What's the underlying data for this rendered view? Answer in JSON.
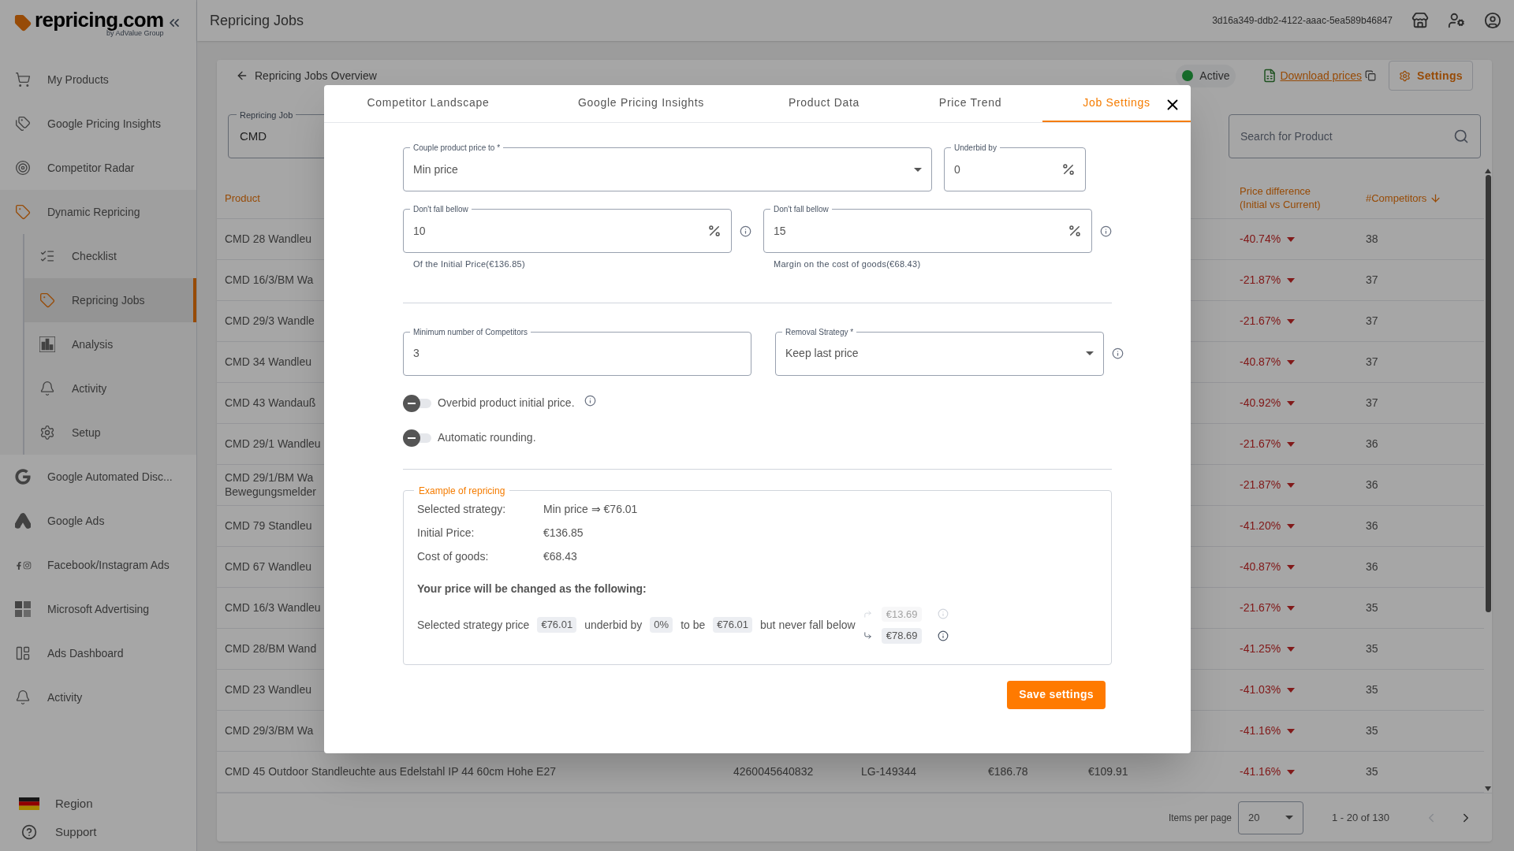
{
  "sidebar": {
    "logo": "repricing.com",
    "logo_tagline": "by AdValue Group",
    "items": [
      {
        "label": "My Products",
        "selected": false
      },
      {
        "label": "Google Pricing Insights",
        "selected": false
      },
      {
        "label": "Competitor Radar",
        "selected": false
      },
      {
        "label": "Dynamic Repricing",
        "selected": true,
        "children": [
          {
            "label": "Checklist",
            "selected": false
          },
          {
            "label": "Repricing Jobs",
            "selected": true
          },
          {
            "label": "Analysis",
            "selected": false
          },
          {
            "label": "Activity",
            "selected": false
          },
          {
            "label": "Setup",
            "selected": false
          }
        ]
      },
      {
        "label": "Google Automated Disc...",
        "selected": false
      },
      {
        "label": "Google Ads",
        "selected": false
      },
      {
        "label": "Facebook/Instagram Ads",
        "selected": false
      },
      {
        "label": "Microsoft Advertising",
        "selected": false
      },
      {
        "label": "Ads Dashboard",
        "selected": false
      },
      {
        "label": "Activity",
        "selected": false
      }
    ],
    "footer": [
      {
        "label": "Region"
      },
      {
        "label": "Support"
      }
    ]
  },
  "topbar": {
    "title": "Repricing Jobs",
    "account_id": "3d16a349-ddb2-4122-aaac-5ea589b46847"
  },
  "page": {
    "back_link": "Repricing Jobs Overview",
    "status": {
      "label": "Active",
      "on": true
    },
    "download_link": "Download prices",
    "settings_button": "Settings",
    "job_field": {
      "label": "Repricing Job",
      "value": "CMD"
    },
    "search": {
      "placeholder": "Search for Product"
    }
  },
  "table": {
    "columns": [
      {
        "label": "Product"
      },
      {
        "label": "Price difference (Initial vs Current)"
      },
      {
        "label": "#Competitors"
      }
    ],
    "rows": [
      {
        "product": "CMD 28 Wandleu",
        "diff": "-40.74%",
        "competitors": "38"
      },
      {
        "product": "CMD 16/3/BM Wa",
        "diff": "-21.87%",
        "competitors": "37"
      },
      {
        "product": "CMD 29/3 Wandle",
        "diff": "-21.67%",
        "competitors": "37"
      },
      {
        "product": "CMD 34 Wandleu",
        "diff": "-40.87%",
        "competitors": "37"
      },
      {
        "product": "CMD 43 Wandauß",
        "diff": "-40.92%",
        "competitors": "37"
      },
      {
        "product": "CMD 29/1 Wandleu",
        "diff": "-21.67%",
        "competitors": "36"
      },
      {
        "product": "CMD 29/1/BM Wa\nBewegungsmelder",
        "diff": "-21.87%",
        "competitors": "36"
      },
      {
        "product": "CMD 79 Standleu",
        "diff": "-41.20%",
        "competitors": "36"
      },
      {
        "product": "CMD 67 Wandleu",
        "diff": "-40.87%",
        "competitors": "36"
      },
      {
        "product": "CMD 16/3 Wandleu",
        "diff": "-21.67%",
        "competitors": "35"
      },
      {
        "product": "CMD 28/BM Wand",
        "diff": "-41.25%",
        "competitors": "35"
      },
      {
        "product": "CMD 23 Wandleu",
        "diff": "-41.03%",
        "competitors": "35"
      },
      {
        "product": "CMD 29/3/BM Wa",
        "diff": "-41.16%",
        "competitors": "35"
      },
      {
        "product": "CMD 45 Outdoor Standleuchte aus Edelstahl IP 44 60cm Hohe E27",
        "extra": [
          "4260045640832",
          "LG-149344",
          "€186.78",
          "€109.91"
        ],
        "diff": "-41.16%",
        "competitors": "35"
      }
    ]
  },
  "pagination": {
    "label": "Items per page",
    "page_size": "20",
    "range": "1 - 20 of 130",
    "prev_disabled": true,
    "next_disabled": false
  },
  "modal": {
    "tabs": [
      {
        "label": "Competitor Landscape",
        "selected": false
      },
      {
        "label": "Google Pricing Insights",
        "selected": false
      },
      {
        "label": "Product Data",
        "selected": false
      },
      {
        "label": "Price Trend",
        "selected": false
      },
      {
        "label": "Job Settings",
        "selected": true
      }
    ],
    "fields": [
      {
        "kind": "select",
        "label": "Couple product price to *",
        "value": "Min price",
        "info": false
      },
      {
        "kind": "percent",
        "label": "Underbid by",
        "value": "0",
        "info": false
      },
      {
        "kind": "percent",
        "label": "Don't fall bellow",
        "value": "10",
        "info": true,
        "helper": "Of the Initial Price(€136.85)"
      },
      {
        "kind": "percent",
        "label": "Don't fall bellow",
        "value": "15",
        "info": true,
        "helper": "Margin on the cost of goods(€68.43)"
      },
      {
        "kind": "text",
        "label": "Minimum number of Competitors",
        "value": "3",
        "info": false
      },
      {
        "kind": "select",
        "label": "Removal Strategy *",
        "value": "Keep last price",
        "info": true
      }
    ],
    "toggles": [
      {
        "label": "Overbid product initial price.",
        "on": false,
        "info": true
      },
      {
        "label": "Automatic rounding.",
        "on": false,
        "info": false
      }
    ],
    "example": {
      "title": "Example of repricing",
      "facts": [
        {
          "label": "Selected strategy:",
          "value": "Min price ⇒ €76.01"
        },
        {
          "label": "Initial Price:",
          "value": "€136.85"
        },
        {
          "label": "Cost of goods:",
          "value": "€68.43"
        }
      ],
      "summary": "Your price will be changed as the following:",
      "sentence": [
        {
          "kind": "text",
          "text": "Selected strategy price"
        },
        {
          "kind": "chip",
          "text": "€76.01"
        },
        {
          "kind": "text",
          "text": "underbid by"
        },
        {
          "kind": "chip",
          "text": "0%"
        },
        {
          "kind": "text",
          "text": "to be"
        },
        {
          "kind": "chip",
          "text": "€76.01"
        },
        {
          "kind": "text",
          "text": "but never fall below"
        }
      ],
      "floors": [
        {
          "value": "€13.69",
          "selected": false
        },
        {
          "value": "€78.69",
          "selected": true
        }
      ]
    },
    "save_button": "Save settings"
  }
}
